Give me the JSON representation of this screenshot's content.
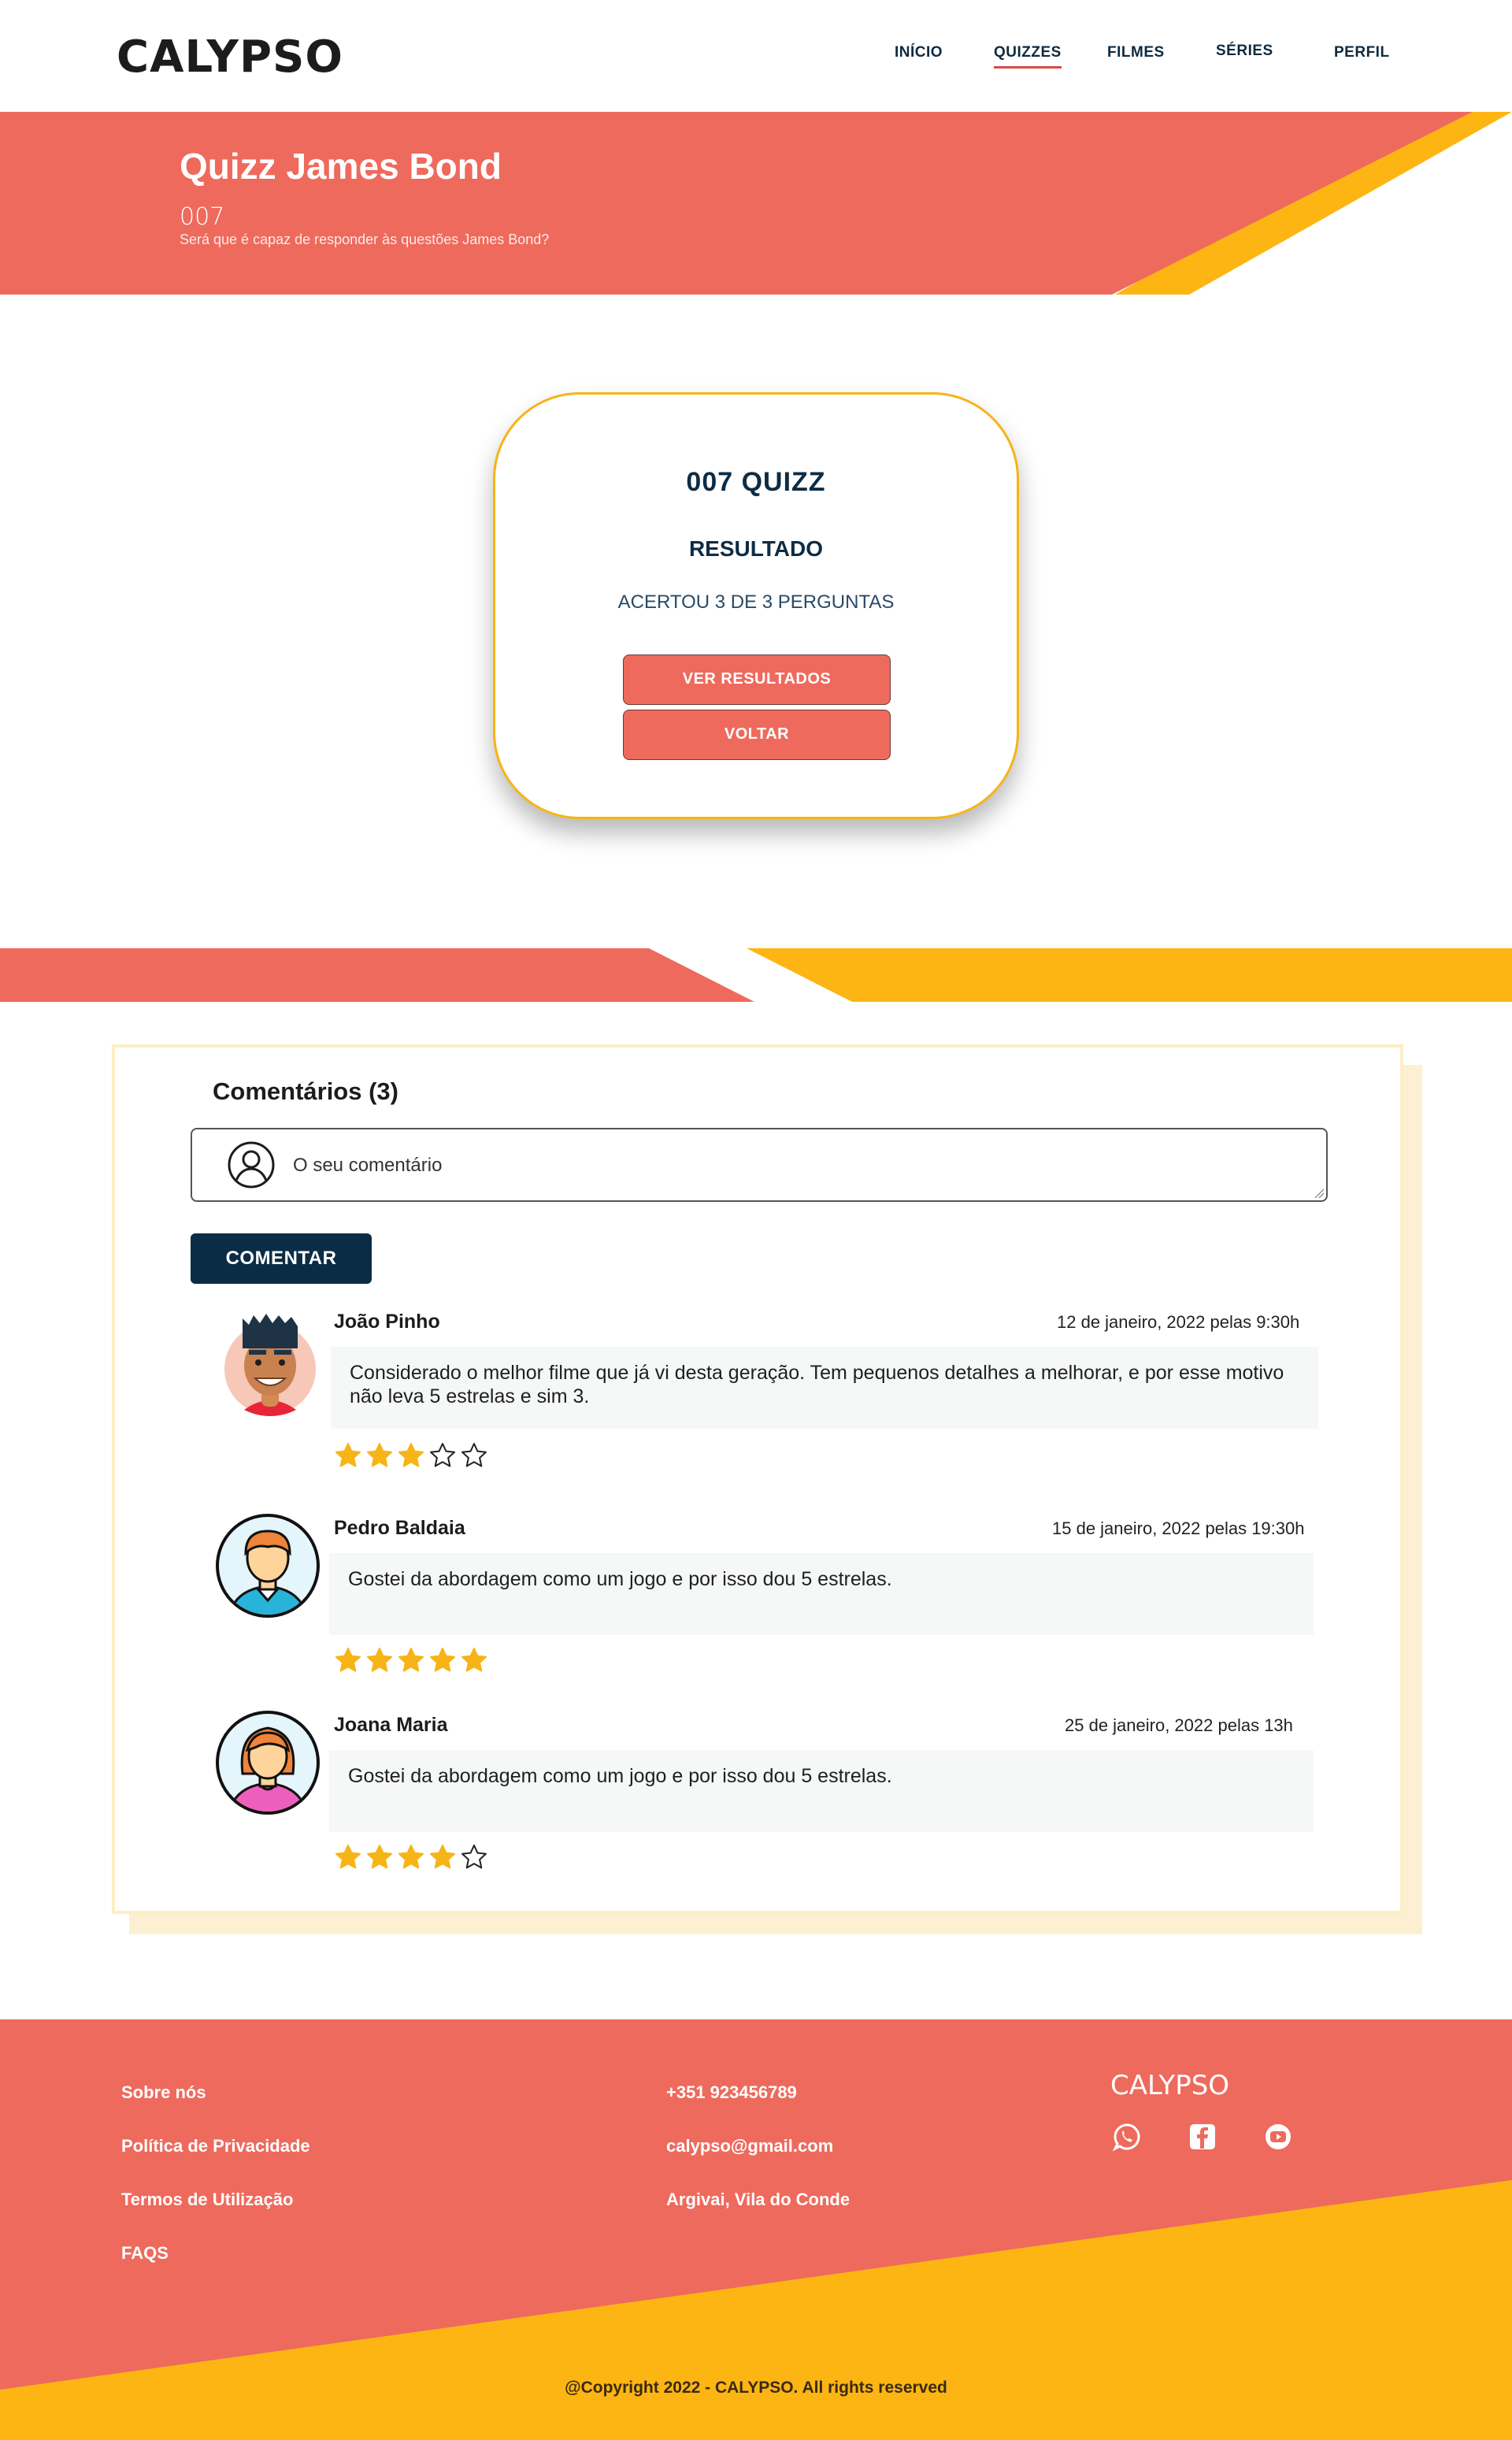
{
  "header": {
    "logo": "CALYPSO",
    "nav": [
      {
        "label": "INÍCIO",
        "active": false
      },
      {
        "label": "QUIZZES",
        "active": true
      },
      {
        "label": "FILMES",
        "active": false
      },
      {
        "label": "SÉRIES",
        "active": false
      },
      {
        "label": "PERFIL",
        "active": false
      }
    ]
  },
  "hero": {
    "title": "Quizz James Bond",
    "subtitle": "007",
    "description": "Será que é capaz de responder às questões James Bond?"
  },
  "result": {
    "title": "007 QUIZZ",
    "heading": "RESULTADO",
    "score": "ACERTOU 3 DE 3 PERGUNTAS",
    "view_button": "VER RESULTADOS",
    "back_button": "VOLTAR"
  },
  "comments": {
    "title": "Comentários (3)",
    "placeholder": "O seu comentário",
    "submit": "COMENTAR",
    "items": [
      {
        "author": "João Pinho",
        "date": "12 de janeiro, 2022 pelas 9:30h",
        "text": "Considerado o melhor filme que já vi desta geração. Tem pequenos detalhes a melhorar, e por esse motivo não leva 5 estrelas e sim 3.",
        "rating": 3,
        "avatar": "man-avatar-icon"
      },
      {
        "author": "Pedro Baldaia",
        "date": "15 de janeiro, 2022 pelas 19:30h",
        "text": "Gostei da abordagem como um jogo e por isso dou 5 estrelas.",
        "rating": 5,
        "avatar": "boy-avatar-icon"
      },
      {
        "author": "Joana Maria",
        "date": "25 de janeiro, 2022 pelas 13h",
        "text": "Gostei da abordagem como um jogo e por isso dou 5 estrelas.",
        "rating": 4,
        "avatar": "girl-avatar-icon"
      }
    ]
  },
  "footer": {
    "links": [
      "Sobre nós",
      "Política de Privacidade",
      "Termos de Utilização",
      "FAQS"
    ],
    "contacts": [
      "+351 923456789",
      "calypso@gmail.com",
      "Argivai, Vila do Conde"
    ],
    "brand": "CALYPSO",
    "social": [
      "whatsapp-icon",
      "facebook-icon",
      "youtube-icon"
    ],
    "copyright": "@Copyright 2022 - CALYPSO. All rights reserved"
  },
  "colors": {
    "coral": "#ee6a5d",
    "yellow": "#fdb514",
    "navy": "#0b2c45",
    "star": "#f7b417"
  }
}
